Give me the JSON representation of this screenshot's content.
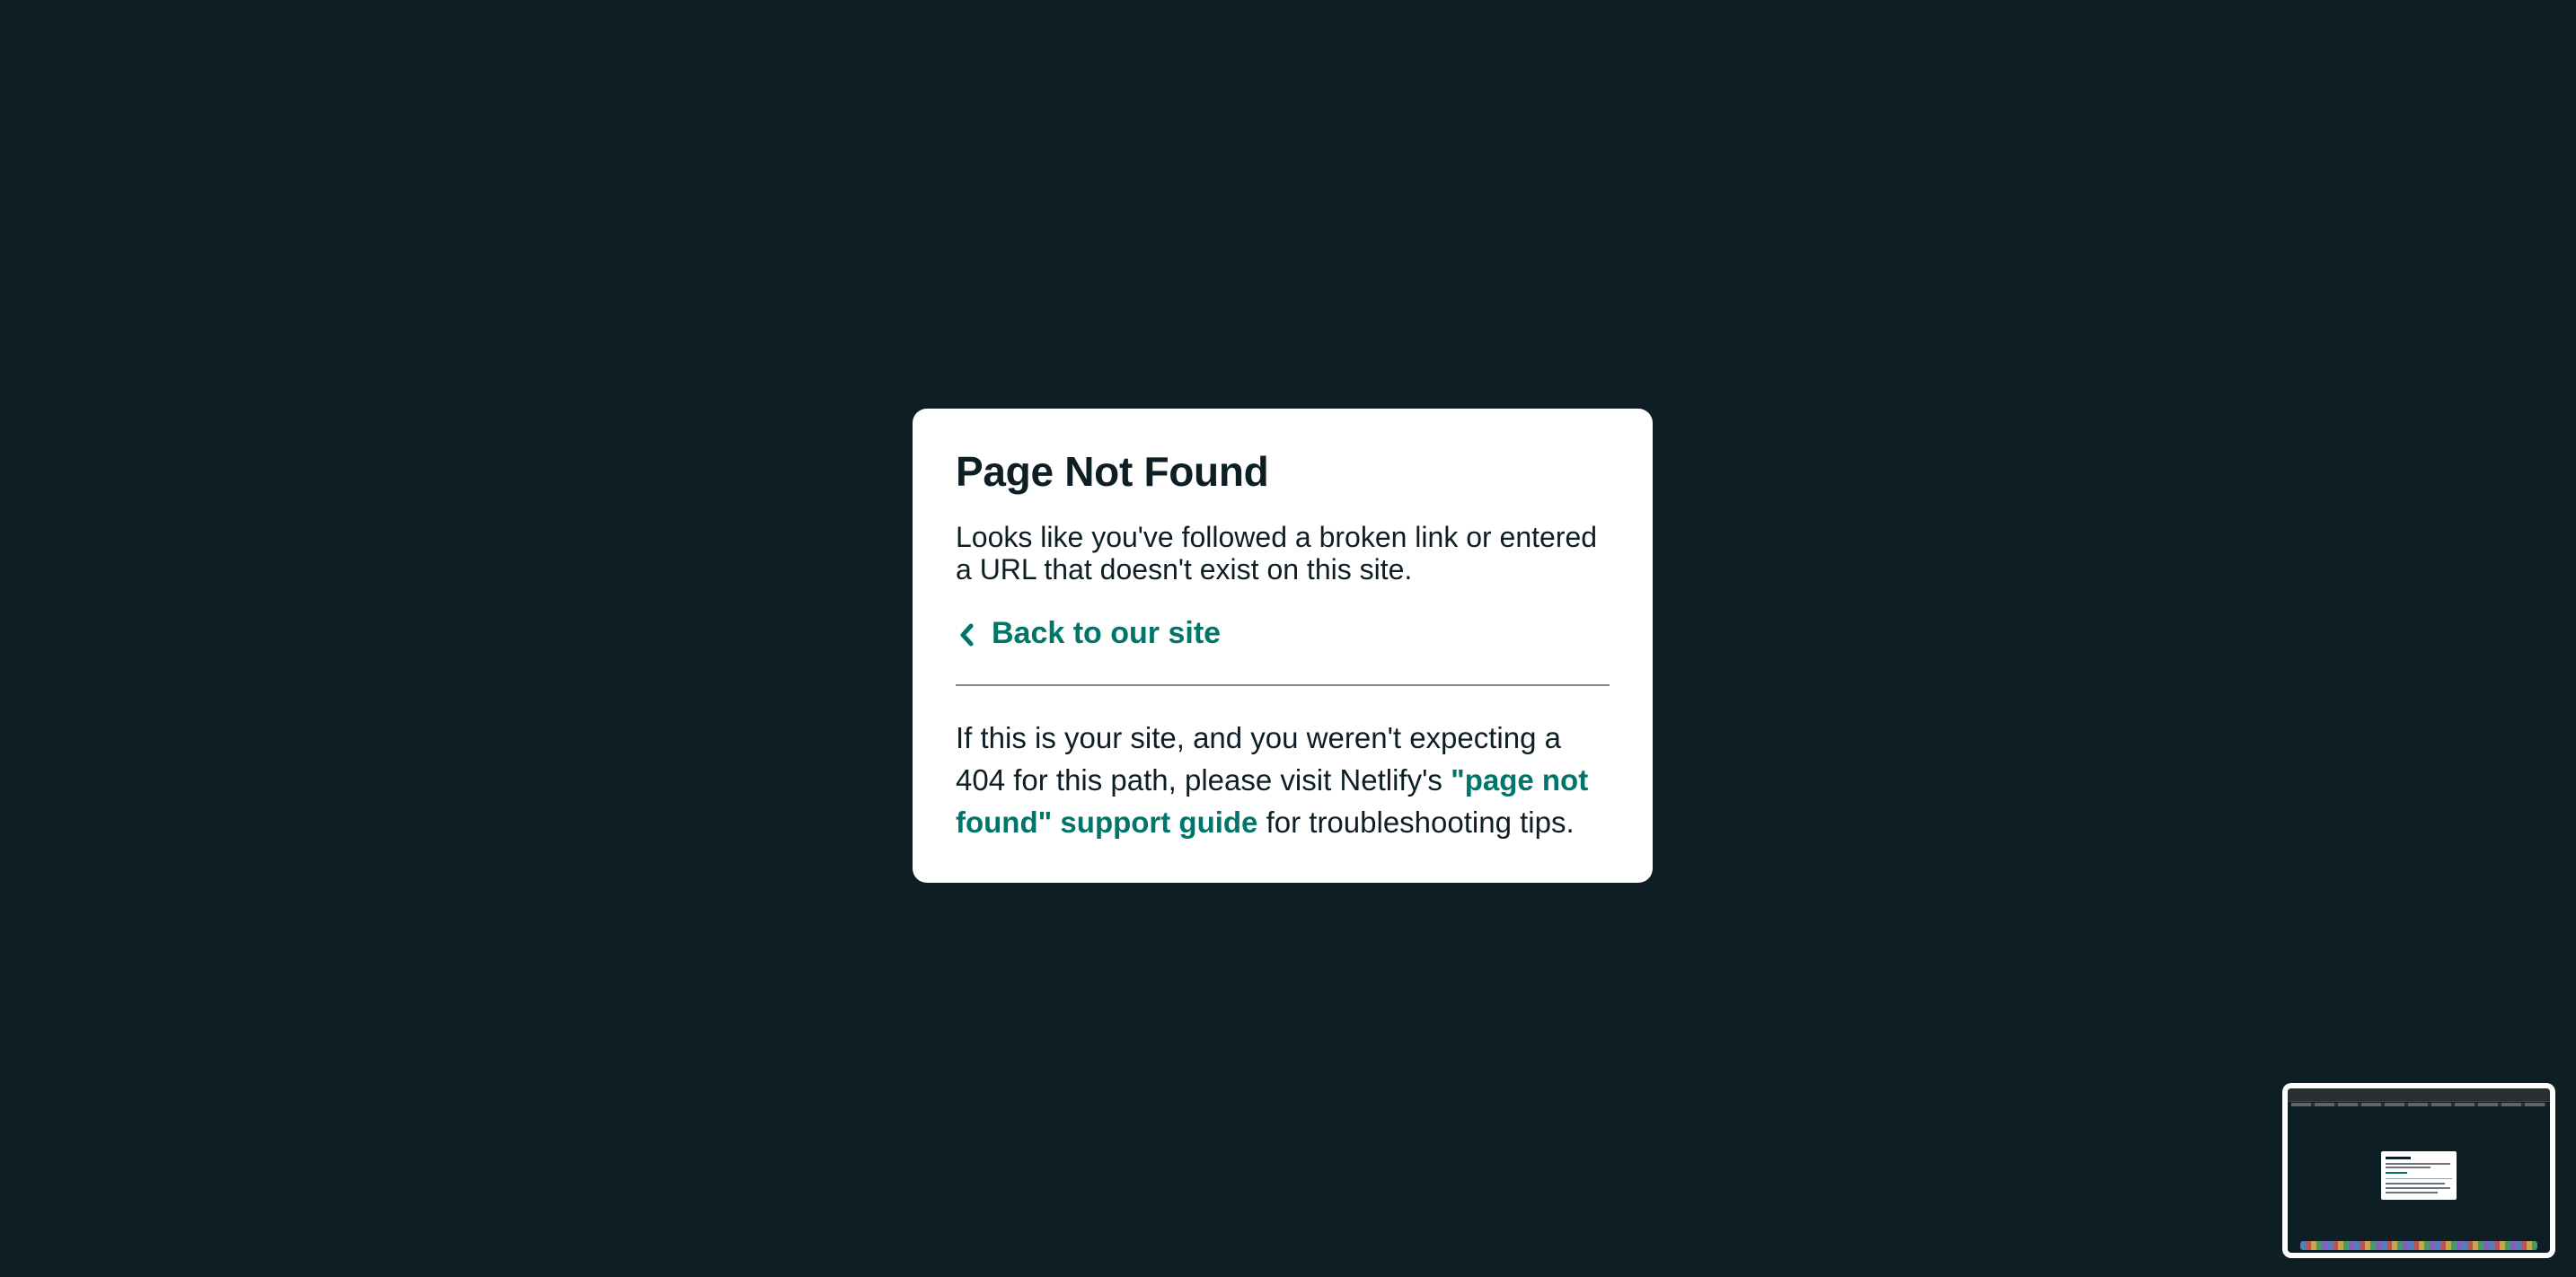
{
  "colors": {
    "background": "#0e1e25",
    "card": "#ffffff",
    "text": "#0e1e25",
    "accent": "#00756a"
  },
  "card": {
    "title": "Page Not Found",
    "description": "Looks like you've followed a broken link or entered a URL that doesn't exist on this site.",
    "back_link": {
      "icon": "chevron-left-icon",
      "label": "Back to our site"
    },
    "help": {
      "before": "If this is your site, and you weren't expecting a 404 for this path, please visit Netlify's ",
      "link": "\"page not found\" support guide",
      "after": " for troubleshooting tips."
    }
  },
  "screenshot_thumbnail": {
    "label": "screenshot preview"
  }
}
